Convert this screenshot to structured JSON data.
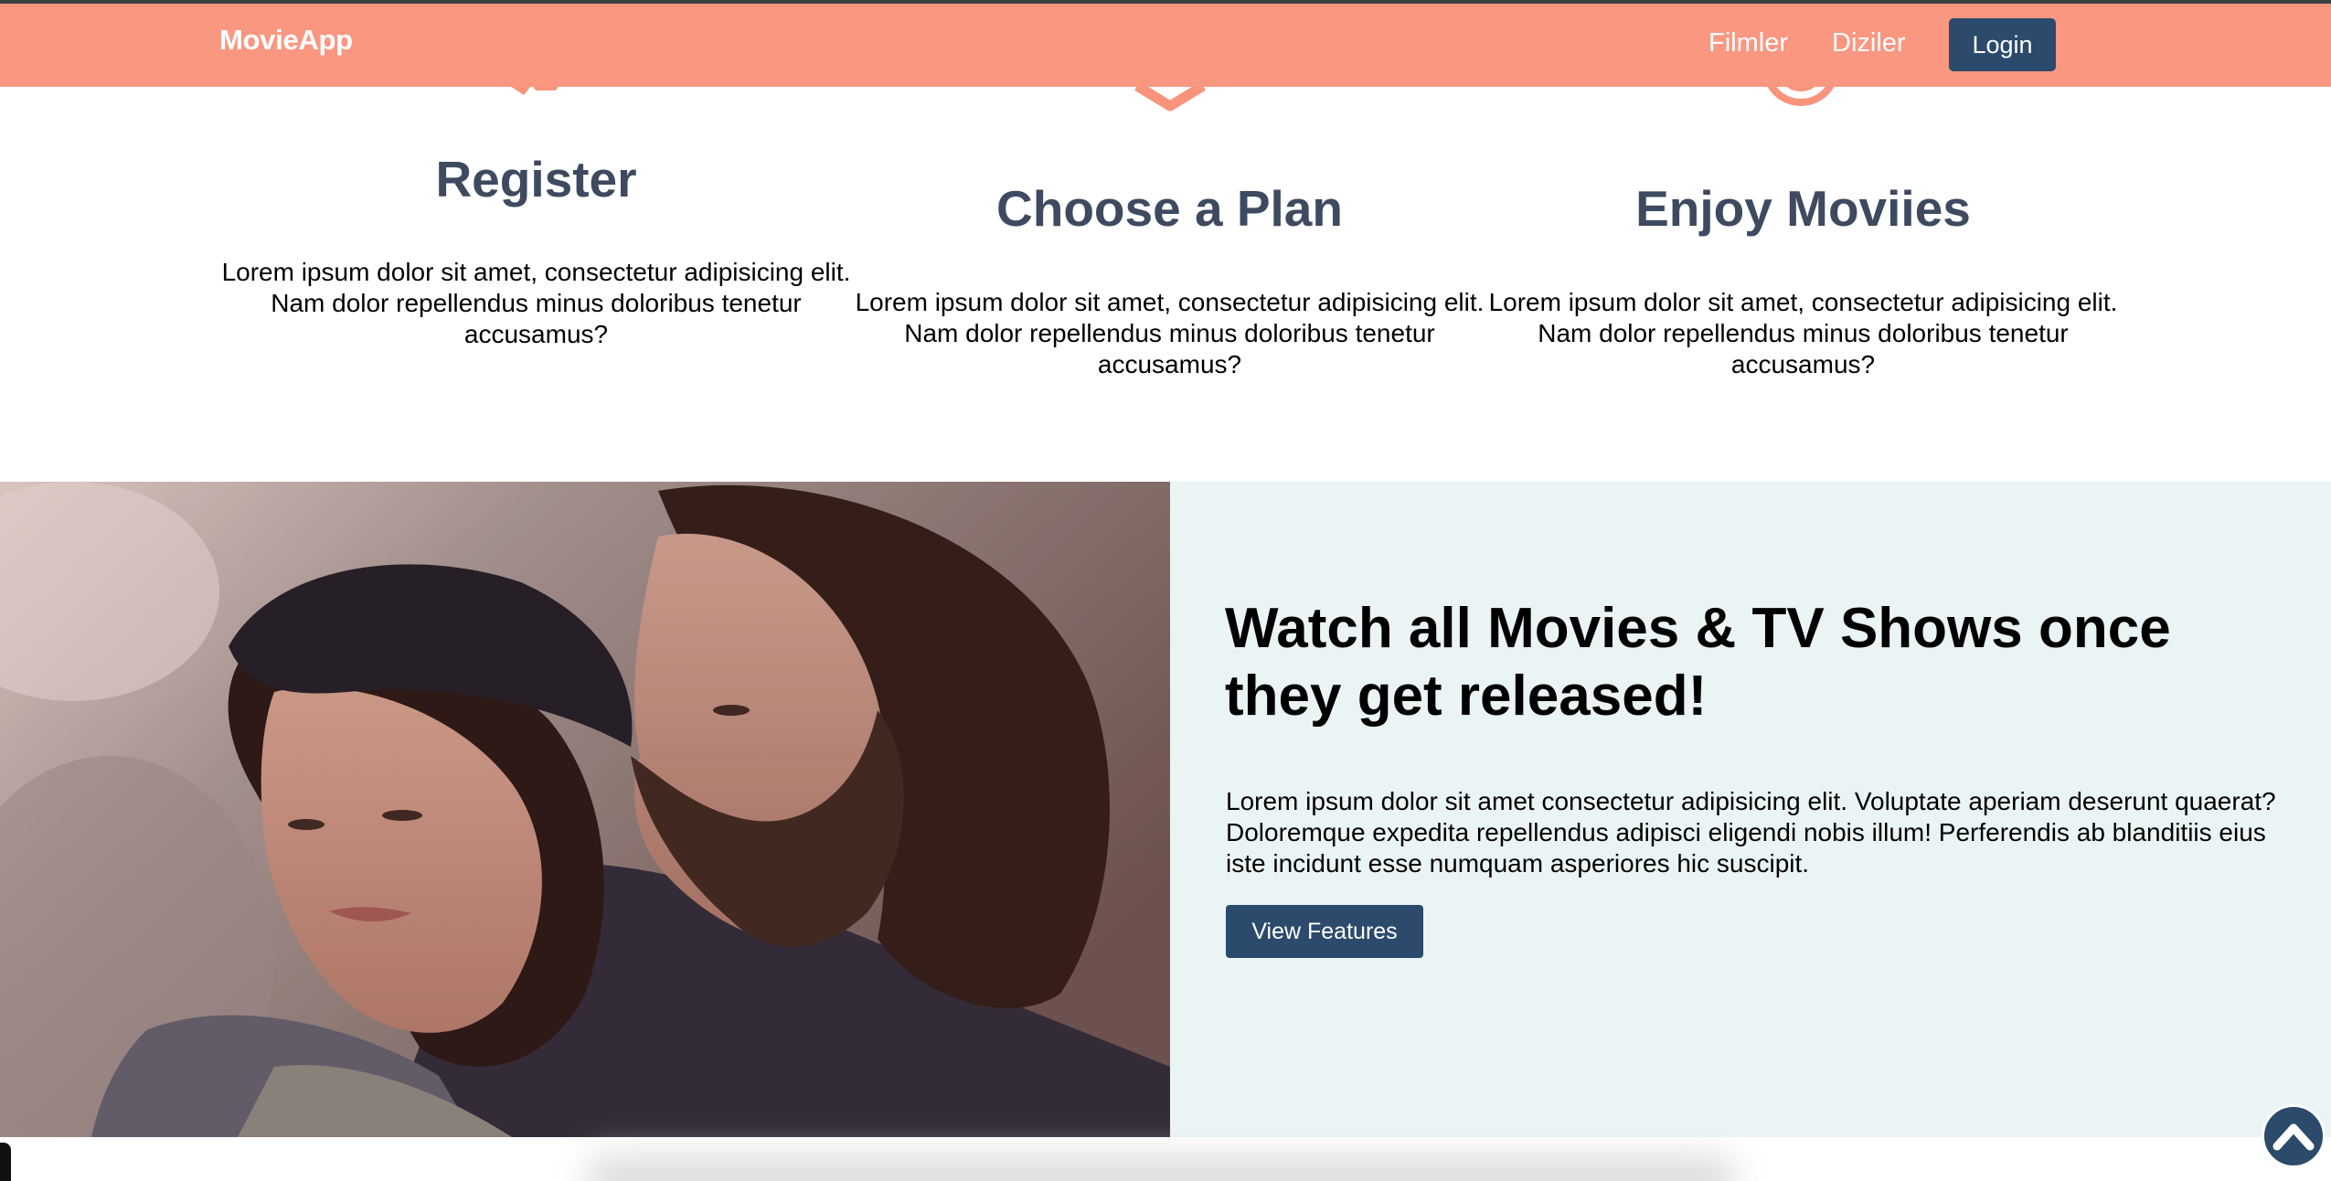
{
  "navbar": {
    "brand": "MovieApp",
    "links": [
      "Filmler",
      "Diziler"
    ],
    "login_label": "Login"
  },
  "steps": [
    {
      "icon": "user-plus-icon",
      "title": "Register",
      "text": "Lorem ipsum dolor sit amet, consectetur adipisicing elit. Nam dolor repellendus minus doloribus tenetur accusamus?"
    },
    {
      "icon": "layers-icon",
      "title": "Choose a Plan",
      "text": "Lorem ipsum dolor sit amet, consectetur adipisicing elit. Nam dolor repellendus minus doloribus tenetur accusamus?"
    },
    {
      "icon": "bullseye-icon",
      "title": "Enjoy Moviies",
      "text": "Lorem ipsum dolor sit amet, consectetur adipisicing elit. Nam dolor repellendus minus doloribus tenetur accusamus?"
    }
  ],
  "feature": {
    "image": "couple-photo",
    "heading": "Watch all Movies & TV Shows once they get released!",
    "text": "Lorem ipsum dolor sit amet consectetur adipisicing elit. Voluptate aperiam deserunt quaerat? Doloremque expedita repellendus adipisci eligendi nobis illum! Perferendis ab blanditiis eius iste incidunt esse numquam asperiores hic suscipit.",
    "button_label": "View Features"
  },
  "scroll_top": {
    "icon": "chevron-up-icon"
  },
  "colors": {
    "navbar": "#fa9781",
    "icon_accent": "#f8937c",
    "primary_button": "#2b4a6c",
    "step_title": "#3d4a60",
    "feature_panel": "#ebf4f5"
  }
}
